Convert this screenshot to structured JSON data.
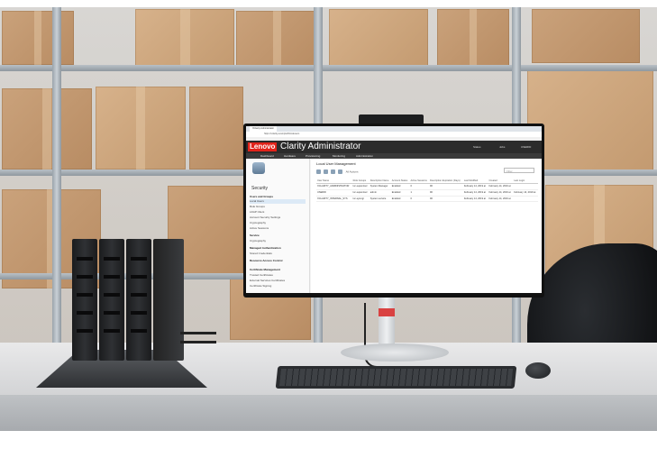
{
  "browser": {
    "tab_label": "XClarity Administrator",
    "address": "https://xclarity.example/#/localusers"
  },
  "app": {
    "brand": "Lenovo",
    "title": "Clarity Administrator",
    "status_items": [
      "Status",
      "Jobs",
      "USERID"
    ],
    "nav": [
      "Dashboard",
      "Hardware",
      "Provisioning",
      "Monitoring",
      "Administration"
    ]
  },
  "sidebar": {
    "title": "Security",
    "items": [
      {
        "label": "Users and Groups",
        "heading": true
      },
      {
        "label": "Local Users",
        "active": true
      },
      {
        "label": "Role Groups"
      },
      {
        "label": "LDAP Client"
      },
      {
        "label": "Account Security Settings"
      },
      {
        "label": "Cryptography"
      },
      {
        "label": "Active Sessions"
      },
      {
        "label": "Service",
        "heading": true
      },
      {
        "label": "Cryptography"
      },
      {
        "label": "Managed Authentication",
        "heading": true
      },
      {
        "label": "Stored Credentials"
      },
      {
        "label": "Resource Access Control",
        "heading": true
      },
      {
        "label": "Certificate Management",
        "heading": true
      },
      {
        "label": "Trusted Certificates"
      },
      {
        "label": "External Services Certificates"
      },
      {
        "label": "Certificate Signing"
      }
    ]
  },
  "main": {
    "title": "Local User Management",
    "toolbar_action": "All Actions",
    "filter_placeholder": "Filter",
    "columns": [
      "User Name",
      "Role Groups",
      "Description Name",
      "Account Status",
      "Active Sessions",
      "Description Expiration (Days)",
      "Last Modified",
      "Created",
      "Last Login"
    ],
    "rows": [
      [
        "XCLARITY_ADMINISTRATOR",
        "lxc-supervisor",
        "System Manager",
        "Enabled",
        "0",
        "90",
        "February 14, 2019 at",
        "February 14, 2019 at",
        ""
      ],
      [
        "USERID",
        "lxc-supervisor",
        "admin",
        "Enabled",
        "1",
        "90",
        "February 14, 2019 at",
        "February 14, 2019 at",
        "February 14, 2019 at"
      ],
      [
        "XCLARITY_INTERNAL_SYS",
        "lxc-sysmgr",
        "System service",
        "Enabled",
        "0",
        "90",
        "February 14, 2019 at",
        "February 14, 2019 at",
        ""
      ]
    ]
  },
  "colors": {
    "lenovo_red": "#e2231a",
    "title_bar": "#2b2b2b",
    "desk": "#e4e5e6",
    "neck_band": "#d94242"
  }
}
